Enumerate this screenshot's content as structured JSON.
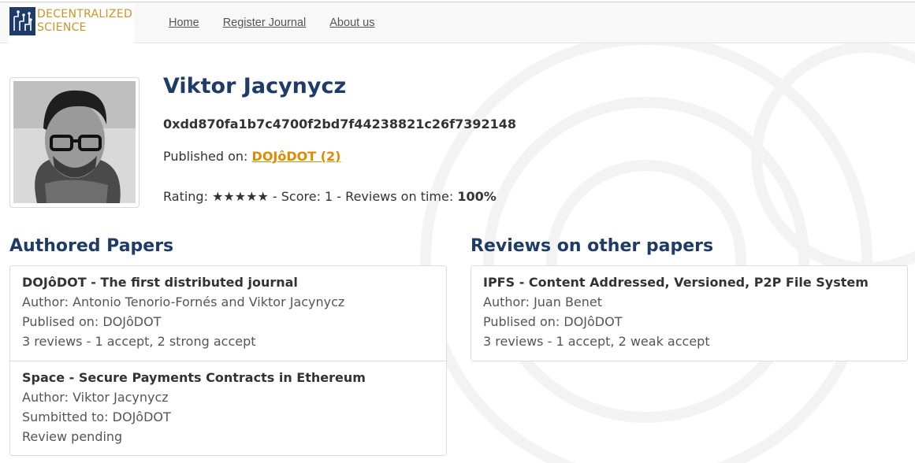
{
  "logo": {
    "line1": "DECENTRALIZED",
    "line2": "SCIENCE"
  },
  "nav": {
    "home": "Home",
    "register": "Register Journal",
    "about": "About us"
  },
  "profile": {
    "name": "Viktor Jacynycz",
    "address": "0xdd870fa1b7c4700f2bd7f44238821c26f7392148",
    "published_label": "Published on:",
    "published_link": "DOJôDOT (2)",
    "rating_label": "Rating:",
    "stars": "★★★★★",
    "score_text": "- Score: 1 - Reviews on time:",
    "on_time": "100%"
  },
  "authored": {
    "title": "Authored Papers",
    "papers": [
      {
        "title": "DOJôDOT - The first distributed journal",
        "line1": "Author: Antonio Tenorio-Fornés and Viktor Jacynycz",
        "line2": "Publised on: DOJôDOT",
        "line3": "3 reviews - 1 accept, 2 strong accept"
      },
      {
        "title": "Space - Secure Payments Contracts in Ethereum",
        "line1": "Author: Viktor Jacynycz",
        "line2": "Sumbitted to: DOJôDOT",
        "line3": "Review pending"
      }
    ]
  },
  "reviews": {
    "title": "Reviews on other papers",
    "papers": [
      {
        "title": "IPFS - Content Addressed, Versioned, P2P File System",
        "line1": "Author: Juan Benet",
        "line2": "Publised on: DOJôDOT",
        "line3": "3 reviews - 1 accept, 2 weak accept"
      }
    ]
  }
}
